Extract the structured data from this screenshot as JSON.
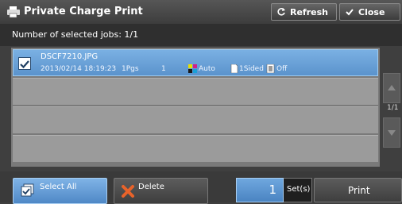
{
  "header": {
    "title": "Private Charge Print",
    "refresh_label": "Refresh",
    "close_label": "Close"
  },
  "subheader": {
    "selected_text": "Number of selected jobs: 1/1"
  },
  "jobs": [
    {
      "name": "DSCF7210.JPG",
      "datetime": "2013/02/14 18:19:23",
      "pages": "1Pgs",
      "copies": "1",
      "color": "Auto",
      "sided": "1Sided",
      "staple": "Off",
      "selected": true
    }
  ],
  "pager": {
    "indicator": "1/1"
  },
  "footer": {
    "select_all_label": "Select All",
    "delete_label": "Delete",
    "sets_value": "1",
    "sets_label": "Set(s)",
    "print_label": "Print"
  },
  "colors": {
    "selection": "#5b93cc",
    "delete_icon": "#e8632a"
  }
}
